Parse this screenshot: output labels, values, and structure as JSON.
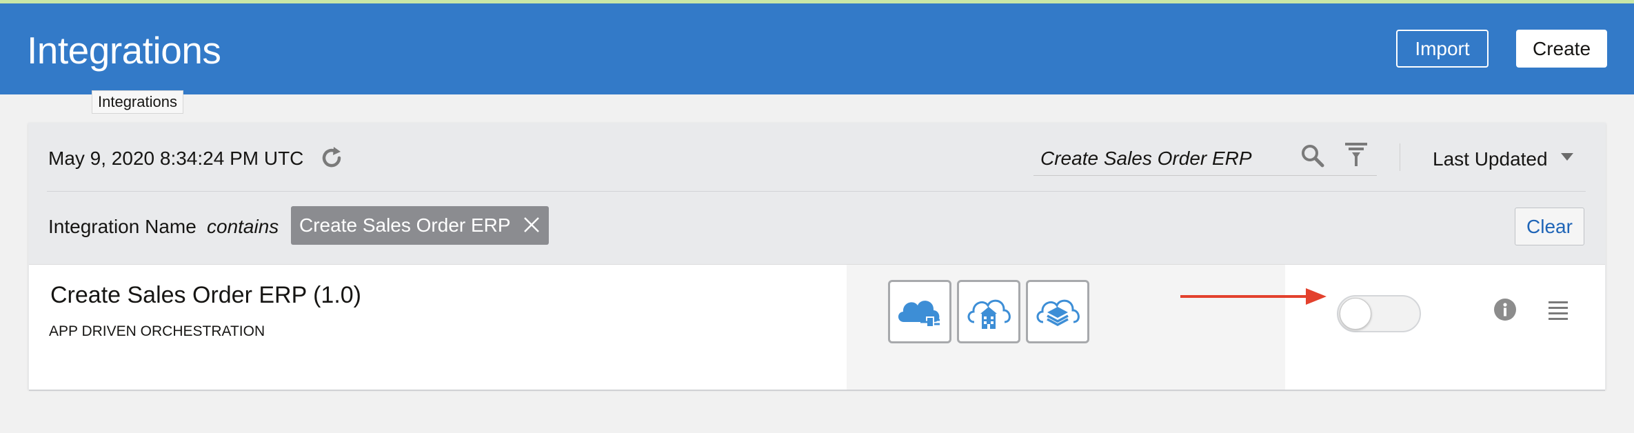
{
  "header": {
    "title": "Integrations",
    "import_label": "Import",
    "create_label": "Create"
  },
  "tooltip": "Integrations",
  "toolbar": {
    "timestamp": "May 9, 2020 8:34:24 PM UTC",
    "search_value": "Create Sales Order ERP",
    "sort_label": "Last Updated"
  },
  "filter": {
    "field": "Integration Name",
    "operator": "contains",
    "chip_value": "Create Sales Order ERP",
    "clear_label": "Clear"
  },
  "integration": {
    "name": "Create Sales Order ERP  (1.0)",
    "type": "APP DRIVEN ORCHESTRATION",
    "connections": [
      "cloud-adapter-icon",
      "cloud-building-icon",
      "cloud-layers-icon"
    ],
    "active": false
  },
  "colors": {
    "header_bg": "#337ac8",
    "chip_bg": "#8b8c90",
    "arrow": "#e3412d",
    "link": "#1f65b7",
    "connection_icon": "#3d8ed6"
  }
}
